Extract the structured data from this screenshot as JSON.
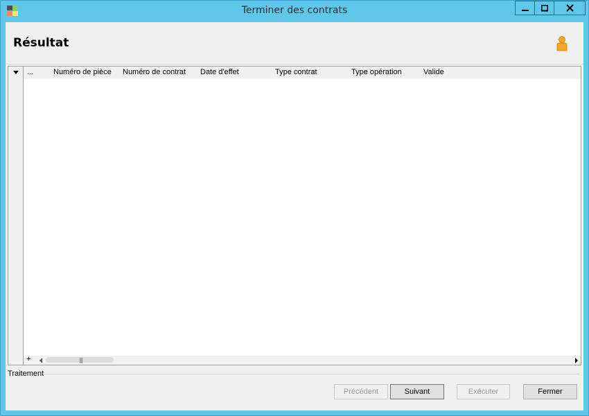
{
  "window": {
    "title": "Terminer des contrats"
  },
  "header": {
    "title": "Résultat"
  },
  "grid": {
    "columns": [
      "...",
      "Numéro de pièce",
      "Numéro de contrat",
      "Date d'effet",
      "Type contrat",
      "Type opération",
      "Valide"
    ],
    "add_label": "+"
  },
  "footer": {
    "group_label": "Traitement",
    "buttons": {
      "previous": "Précédent",
      "next": "Suivant",
      "execute": "Exécuter",
      "close": "Fermer"
    }
  },
  "icons": {
    "app": "app-icon",
    "user": "user-icon"
  },
  "colors": {
    "titlebar": "#5ec7ea",
    "user_icon": "#f5a623"
  }
}
